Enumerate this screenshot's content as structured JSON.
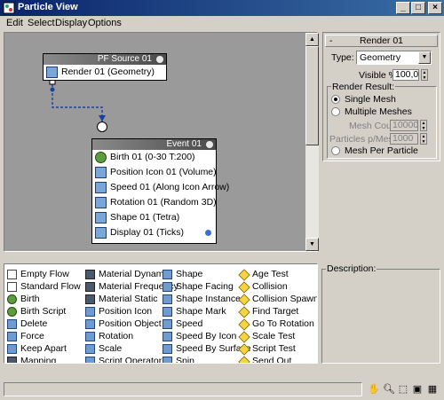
{
  "window": {
    "title": "Particle View"
  },
  "menu": {
    "items": [
      "Edit",
      "Select",
      "Display",
      "Options"
    ]
  },
  "graph": {
    "source_node": {
      "title": "PF Source 01",
      "operator": "Render 01 (Geometry)"
    },
    "event_node": {
      "title": "Event 01",
      "operators": [
        "Birth 01 (0-30 T:200)",
        "Position Icon 01 (Volume)",
        "Speed 01 (Along Icon Arrow)",
        "Rotation 01 (Random 3D)",
        "Shape 01 (Tetra)",
        "Display 01 (Ticks)"
      ],
      "display_color": "#3a6ed0"
    }
  },
  "rollout": {
    "title": "Render 01",
    "type_label": "Type:",
    "type_value": "Geometry",
    "visible_label": "Visible %",
    "visible_value": "100,0",
    "group_label": "Render Result:",
    "single_mesh": "Single Mesh",
    "multiple_meshes": "Multiple Meshes",
    "mesh_count_label": "Mesh Count:",
    "mesh_count_value": "10000",
    "particles_per_mesh_label": "Particles p/Mesh:",
    "particles_per_mesh_value": "1000",
    "mesh_per_particle": "Mesh Per Particle",
    "selected_option": "Single Mesh"
  },
  "depot": {
    "columns": [
      [
        "Empty Flow",
        "Standard Flow",
        "Birth",
        "Birth Script",
        "Delete",
        "Force",
        "Keep Apart",
        "Mapping"
      ],
      [
        "Material Dynamic",
        "Material Frequency",
        "Material Static",
        "Position Icon",
        "Position Object",
        "Rotation",
        "Scale",
        "Script Operator"
      ],
      [
        "Shape",
        "Shape Facing",
        "Shape Instance",
        "Shape Mark",
        "Speed",
        "Speed By Icon",
        "Speed By Surface",
        "Spin"
      ],
      [
        "Age Test",
        "Collision",
        "Collision Spawn",
        "Find Target",
        "Go To Rotation",
        "Scale Test",
        "Script Test",
        "Send Out"
      ]
    ]
  },
  "description": {
    "label": "Description:"
  },
  "colors": {
    "titlebar": "#0a246a",
    "background": "#d4d0c8",
    "graph_bg": "#9a9a9a"
  }
}
